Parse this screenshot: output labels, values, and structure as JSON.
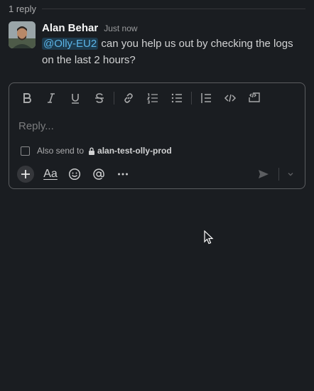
{
  "thread": {
    "reply_count": "1 reply"
  },
  "message": {
    "author": "Alan Behar",
    "timestamp": "Just now",
    "mention": "@Olly-EU2",
    "text": " can you help us out by checking the logs on the last 2 hours?"
  },
  "composer": {
    "placeholder": "Reply...",
    "also_send_label": "Also send to",
    "channel_name": "alan-test-olly-prod",
    "text_format_label": "Aa",
    "formatting_icons": [
      "bold-icon",
      "italic-icon",
      "underline-icon",
      "strikethrough-icon",
      "link-icon",
      "ordered-list-icon",
      "bulleted-list-icon",
      "blockquote-icon",
      "code-icon",
      "code-block-icon"
    ],
    "bottom_icons": [
      "plus-icon",
      "text-format-icon",
      "emoji-icon",
      "mention-icon",
      "more-icon",
      "send-icon",
      "chevron-down-icon"
    ]
  },
  "colors": {
    "background": "#1a1d21",
    "mention_bg": "#1d3a4d",
    "mention_text": "#5cb5e8",
    "composer_border": "#5b5d60"
  }
}
